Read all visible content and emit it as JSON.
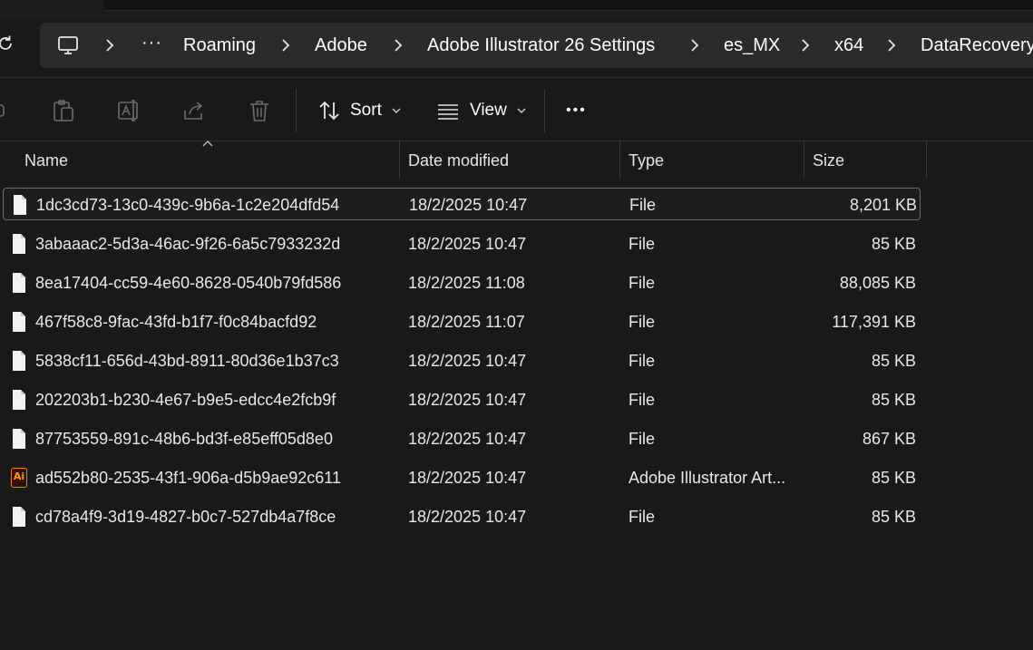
{
  "address_bar": {
    "ellipsis": "···",
    "crumbs": [
      "Roaming",
      "Adobe",
      "Adobe Illustrator 26 Settings",
      "es_MX",
      "x64",
      "DataRecovery"
    ]
  },
  "toolbar": {
    "sort_label": "Sort",
    "view_label": "View",
    "more_label": "•••"
  },
  "columns": {
    "name": "Name",
    "date_modified": "Date modified",
    "type": "Type",
    "size": "Size"
  },
  "files": [
    {
      "name": "1dc3cd73-13c0-439c-9b6a-1c2e204dfd54",
      "date": "18/2/2025 10:47",
      "type": "File",
      "size": "8,201 KB",
      "icon": "file-icon",
      "selected": true
    },
    {
      "name": "3abaaac2-5d3a-46ac-9f26-6a5c7933232d",
      "date": "18/2/2025 10:47",
      "type": "File",
      "size": "85 KB",
      "icon": "file-icon"
    },
    {
      "name": "8ea17404-cc59-4e60-8628-0540b79fd586",
      "date": "18/2/2025 11:08",
      "type": "File",
      "size": "88,085 KB",
      "icon": "file-icon"
    },
    {
      "name": "467f58c8-9fac-43fd-b1f7-f0c84bacfd92",
      "date": "18/2/2025 11:07",
      "type": "File",
      "size": "117,391 KB",
      "icon": "file-icon"
    },
    {
      "name": "5838cf11-656d-43bd-8911-80d36e1b37c3",
      "date": "18/2/2025 10:47",
      "type": "File",
      "size": "85 KB",
      "icon": "file-icon"
    },
    {
      "name": "202203b1-b230-4e67-b9e5-edcc4e2fcb9f",
      "date": "18/2/2025 10:47",
      "type": "File",
      "size": "85 KB",
      "icon": "file-icon"
    },
    {
      "name": "87753559-891c-48b6-bd3f-e85eff05d8e0",
      "date": "18/2/2025 10:47",
      "type": "File",
      "size": "867 KB",
      "icon": "file-icon"
    },
    {
      "name": "ad552b80-2535-43f1-906a-d5b9ae92c611",
      "date": "18/2/2025 10:47",
      "type": "Adobe Illustrator Art...",
      "size": "85 KB",
      "icon": "illustrator-icon",
      "badge": "Ai"
    },
    {
      "name": "cd78a4f9-3d19-4827-b0c7-527db4a7f8ce",
      "date": "18/2/2025 10:47",
      "type": "File",
      "size": "85 KB",
      "icon": "file-icon"
    }
  ],
  "colors": {
    "background": "#191919",
    "address_bar": "#2b2b2b",
    "illustrator_orange": "#ff7c00"
  }
}
